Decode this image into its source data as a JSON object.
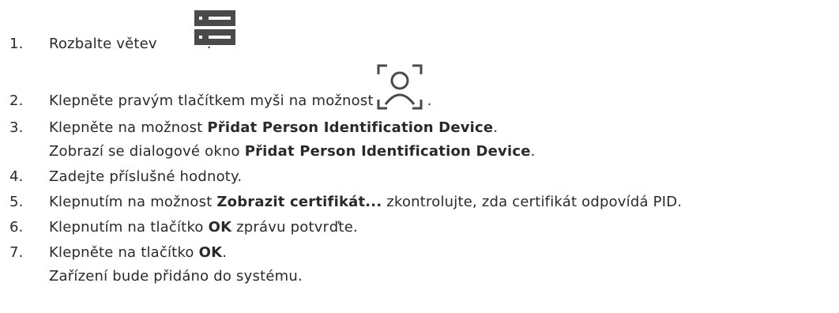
{
  "steps": [
    {
      "num": "1.",
      "parts": [
        "Rozbalte větev ",
        "."
      ]
    },
    {
      "num": "2.",
      "parts": [
        "Klepněte pravým tlačítkem myši na možnost ",
        "."
      ]
    },
    {
      "num": "3.",
      "parts": [
        "Klepněte na možnost ",
        "Přidat Person Identification Device",
        "."
      ]
    },
    {
      "num": "",
      "parts": [
        "Zobrazí se dialogové okno ",
        "Přidat Person Identification Device",
        "."
      ]
    },
    {
      "num": "4.",
      "parts": [
        "Zadejte příslušné hodnoty."
      ]
    },
    {
      "num": "5.",
      "parts": [
        "Klepnutím na možnost ",
        "Zobrazit certifikát...",
        " zkontrolujte, zda certifikát odpovídá PID."
      ]
    },
    {
      "num": "6.",
      "parts": [
        "Klepnutím na tlačítko ",
        "OK",
        " zprávu potvrďte."
      ]
    },
    {
      "num": "7.",
      "parts": [
        "Klepněte na tlačítko ",
        "OK",
        "."
      ]
    },
    {
      "num": "",
      "parts": [
        "Zařízení bude přidáno do systému."
      ]
    }
  ],
  "icons": {
    "server_tree": "server-tree-icon",
    "person_identification": "person-identification-icon"
  },
  "colors": {
    "text": "#2a2a2a",
    "icon": "#4a4a4a"
  }
}
